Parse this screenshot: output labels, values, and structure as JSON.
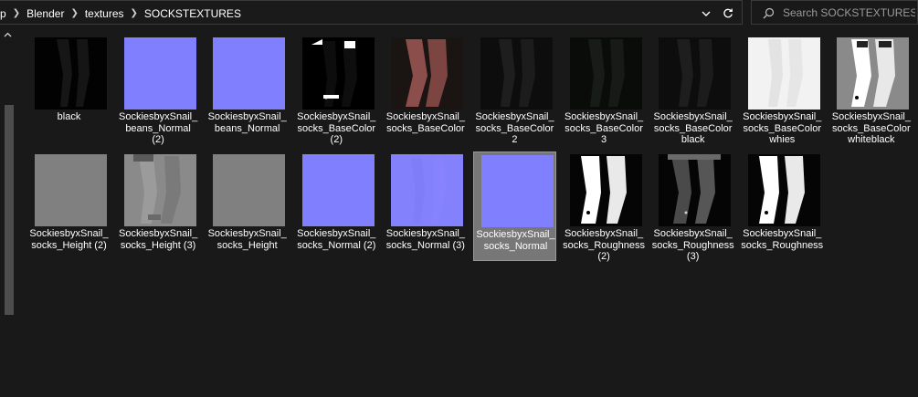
{
  "address_bar": {
    "breadcrumbs": [
      "p",
      "Blender",
      "textures",
      "SOCKSTEXTURES"
    ],
    "dropdown_icon": "chevron-down-icon",
    "refresh_icon": "refresh-icon"
  },
  "search": {
    "placeholder": "Search SOCKSTEXTURES",
    "value": ""
  },
  "files": [
    {
      "label": "black",
      "thumb": "black"
    },
    {
      "label": "SockiesbyxSnail_\nbeans_Normal\n(2)",
      "thumb": "normal"
    },
    {
      "label": "SockiesbyxSnail_\nbeans_Normal",
      "thumb": "normal"
    },
    {
      "label": "SockiesbyxSnail_\nsocks_BaseColor\n(2)",
      "thumb": "basecolor2"
    },
    {
      "label": "SockiesbyxSnail_\nsocks_BaseColor",
      "thumb": "basecolor_red"
    },
    {
      "label": "SockiesbyxSnail_\nsocks_BaseColor\n2",
      "thumb": "dark_socks"
    },
    {
      "label": "SockiesbyxSnail_\nsocks_BaseColor\n3",
      "thumb": "dark_socks_green"
    },
    {
      "label": "SockiesbyxSnail_\nsocks_BaseColor\nblack",
      "thumb": "dark_socks"
    },
    {
      "label": "SockiesbyxSnail_\nsocks_BaseColor\nwhies",
      "thumb": "white_socks"
    },
    {
      "label": "SockiesbyxSnail_\nsocks_BaseColor\nwhiteblack",
      "thumb": "whiteblack"
    },
    {
      "label": "SockiesbyxSnail_\nsocks_Height (2)",
      "thumb": "height"
    },
    {
      "label": "SockiesbyxSnail_\nsocks_Height (3)",
      "thumb": "height_socks"
    },
    {
      "label": "SockiesbyxSnail_\nsocks_Height",
      "thumb": "height"
    },
    {
      "label": "SockiesbyxSnail_\nsocks_Normal (2)",
      "thumb": "normal"
    },
    {
      "label": "SockiesbyxSnail_\nsocks_Normal (3)",
      "thumb": "normal_detail"
    },
    {
      "label": "SockiesbyxSnail_\nsocks_Normal",
      "thumb": "normal",
      "selected": true
    },
    {
      "label": "SockiesbyxSnail_\nsocks_Roughness\n(2)",
      "thumb": "rough_white"
    },
    {
      "label": "SockiesbyxSnail_\nsocks_Roughness\n(3)",
      "thumb": "rough_gray"
    },
    {
      "label": "SockiesbyxSnail_\nsocks_Roughness",
      "thumb": "rough_white"
    }
  ],
  "colors": {
    "background": "#191919",
    "selection": "#777777",
    "normal_map": "#8080ff",
    "text": "#ffffff"
  }
}
